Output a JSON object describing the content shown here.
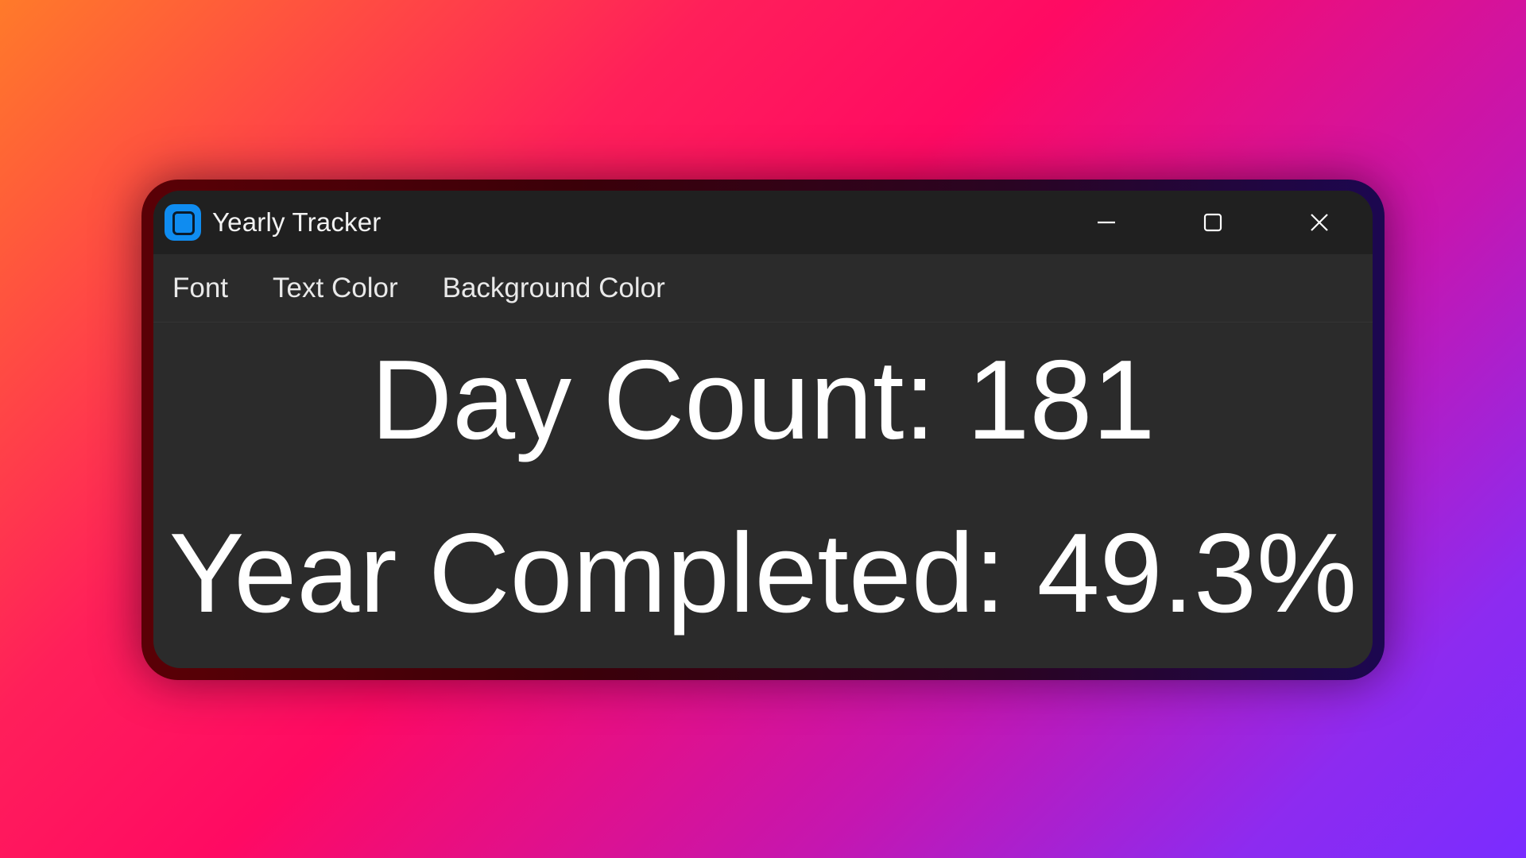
{
  "window": {
    "title": "Yearly Tracker",
    "accent_color": "#0f8cf0",
    "controls": {
      "minimize_icon": "minimize-icon",
      "maximize_icon": "maximize-icon",
      "close_icon": "close-icon"
    }
  },
  "menu": {
    "items": [
      {
        "label": "Font"
      },
      {
        "label": "Text Color"
      },
      {
        "label": "Background Color"
      }
    ]
  },
  "content": {
    "day_count_text": "Day Count: 181",
    "year_completed_text": "Year Completed: 49.3%"
  }
}
